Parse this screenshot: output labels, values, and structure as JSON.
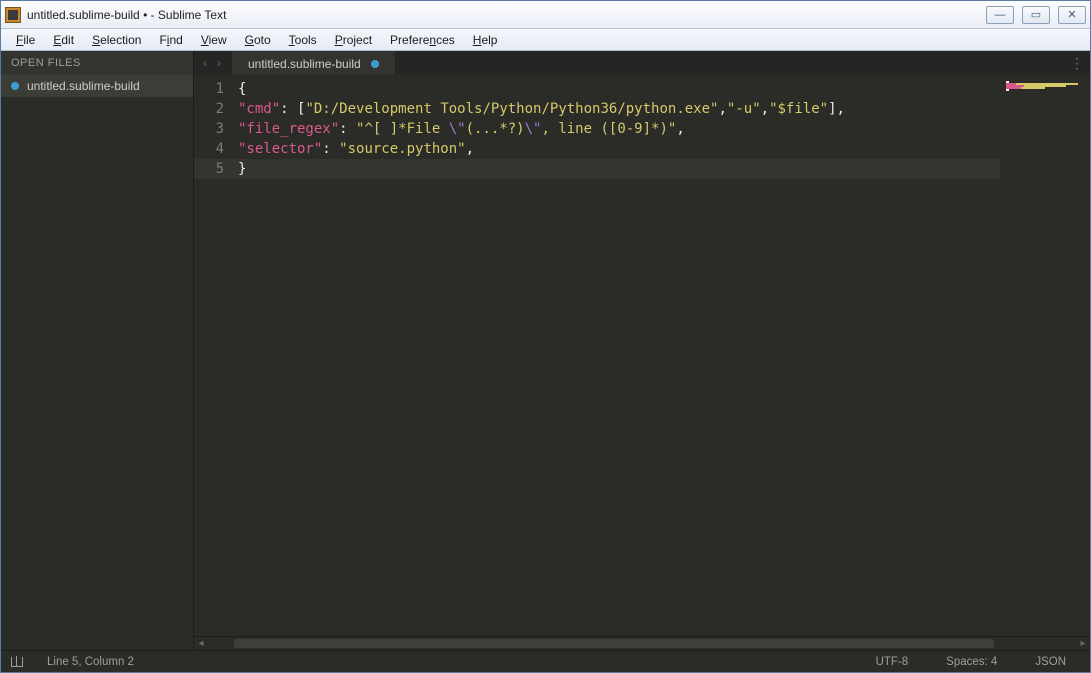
{
  "window": {
    "title": "untitled.sublime-build • - Sublime Text"
  },
  "menubar": {
    "items": [
      "File",
      "Edit",
      "Selection",
      "Find",
      "View",
      "Goto",
      "Tools",
      "Project",
      "Preferences",
      "Help"
    ]
  },
  "sidebar": {
    "header": "OPEN FILES",
    "files": [
      {
        "name": "untitled.sublime-build",
        "dirty": true
      }
    ]
  },
  "tabs": {
    "active": {
      "name": "untitled.sublime-build",
      "dirty": true
    }
  },
  "editor": {
    "line_numbers": [
      "1",
      "2",
      "3",
      "4",
      "5"
    ],
    "current_line": 5,
    "lines": [
      [
        {
          "t": "{",
          "c": "punct"
        }
      ],
      [
        {
          "t": "\"cmd\"",
          "c": "key"
        },
        {
          "t": ": [",
          "c": "punct"
        },
        {
          "t": "\"D:/Development Tools/Python/Python36/python.exe\"",
          "c": "str"
        },
        {
          "t": ",",
          "c": "punct"
        },
        {
          "t": "\"-u\"",
          "c": "str"
        },
        {
          "t": ",",
          "c": "punct"
        },
        {
          "t": "\"$file\"",
          "c": "str"
        },
        {
          "t": "],",
          "c": "punct"
        }
      ],
      [
        {
          "t": "\"file_regex\"",
          "c": "key"
        },
        {
          "t": ": ",
          "c": "punct"
        },
        {
          "t": "\"^[ ]*File ",
          "c": "str"
        },
        {
          "t": "\\\"",
          "c": "esc"
        },
        {
          "t": "(...*?)",
          "c": "str"
        },
        {
          "t": "\\\"",
          "c": "esc"
        },
        {
          "t": ", line ([0-9]*)\"",
          "c": "str"
        },
        {
          "t": ",",
          "c": "punct"
        }
      ],
      [
        {
          "t": "\"selector\"",
          "c": "key"
        },
        {
          "t": ": ",
          "c": "punct"
        },
        {
          "t": "\"source.python\"",
          "c": "str"
        },
        {
          "t": ",",
          "c": "punct"
        }
      ],
      [
        {
          "t": "}",
          "c": "punct"
        }
      ]
    ]
  },
  "statusbar": {
    "position": "Line 5, Column 2",
    "encoding": "UTF-8",
    "indent": "Spaces: 4",
    "syntax": "JSON"
  }
}
